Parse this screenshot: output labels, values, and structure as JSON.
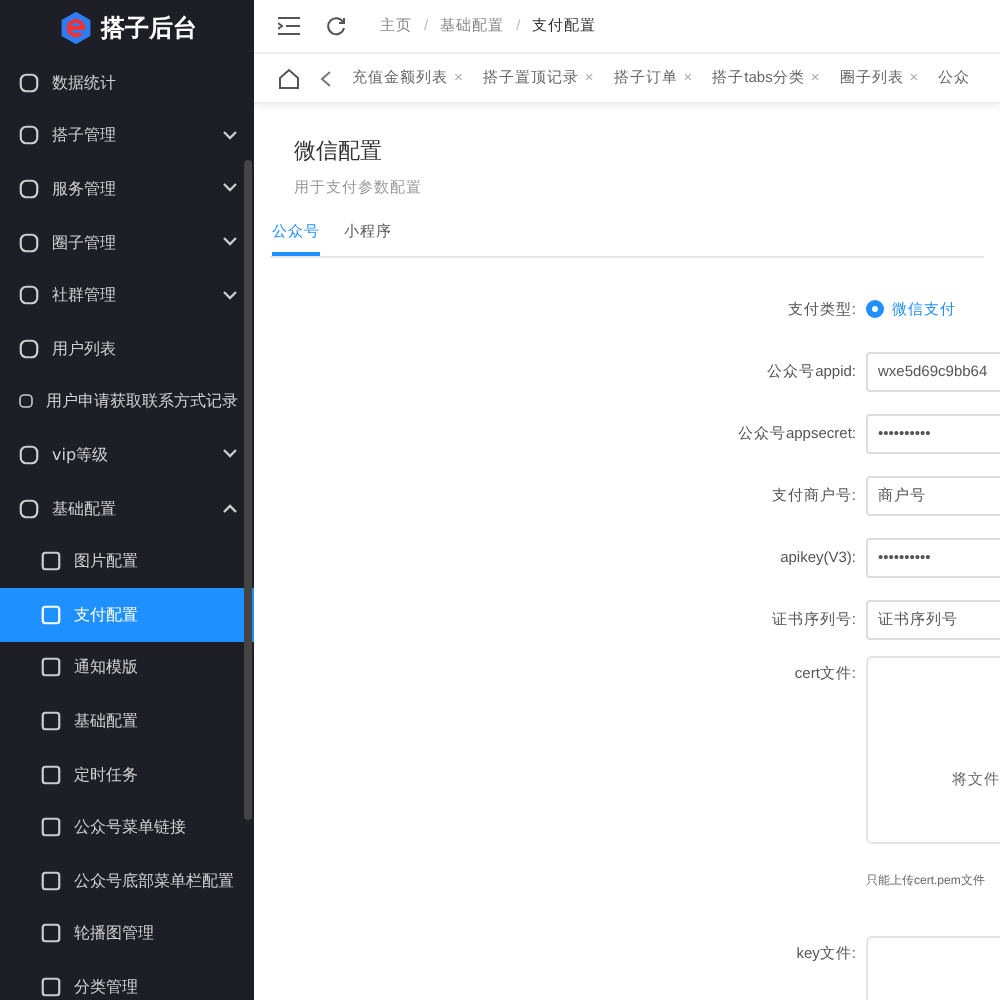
{
  "sidebar": {
    "logo_text": "搭子后台",
    "items": [
      {
        "label": "数据统计"
      },
      {
        "label": "搭子管理",
        "expanded": false
      },
      {
        "label": "服务管理",
        "expanded": false
      },
      {
        "label": "圈子管理",
        "expanded": false
      },
      {
        "label": "社群管理",
        "expanded": false
      },
      {
        "label": "用户列表"
      },
      {
        "label": "用户申请获取联系方式记录"
      },
      {
        "label": "vip等级",
        "expanded": false
      },
      {
        "label": "基础配置",
        "expanded": true,
        "children": [
          {
            "label": "图片配置",
            "selected": false
          },
          {
            "label": "支付配置",
            "selected": true
          },
          {
            "label": "通知模版",
            "selected": false
          },
          {
            "label": "基础配置",
            "selected": false
          },
          {
            "label": "定时任务",
            "selected": false
          },
          {
            "label": "公众号菜单链接",
            "selected": false
          },
          {
            "label": "公众号底部菜单栏配置",
            "selected": false
          },
          {
            "label": "轮播图管理",
            "selected": false
          },
          {
            "label": "分类管理",
            "selected": false
          }
        ]
      }
    ]
  },
  "breadcrumb": [
    {
      "label": "主页"
    },
    {
      "separator": "/",
      "label": "基础配置"
    },
    {
      "separator": "/",
      "label": "支付配置"
    }
  ],
  "tags": [
    {
      "label": "充值金额列表",
      "close": "×"
    },
    {
      "label": "搭子置顶记录",
      "close": "×"
    },
    {
      "label": "搭子订单",
      "close": "×"
    },
    {
      "label": "搭子tabs分类",
      "close": "×"
    },
    {
      "label": "圈子列表",
      "close": "×"
    },
    {
      "label": "公众"
    }
  ],
  "page": {
    "title": "微信配置",
    "subtitle": "用于支付参数配置"
  },
  "tabs": [
    {
      "label": "公众号",
      "selected": true
    },
    {
      "label": "小程序",
      "selected": false
    }
  ],
  "form": [
    {
      "kind": "radio",
      "label": "支付类型:",
      "options": [
        {
          "label": "微信支付",
          "selected": true
        }
      ]
    },
    {
      "kind": "input",
      "label": "公众号appid:",
      "value": "wxe5d69c9bb64"
    },
    {
      "kind": "input",
      "label": "公众号appsecret:",
      "value": "••••••••••"
    },
    {
      "kind": "input",
      "label": "支付商户号:",
      "placeholder": "商户号"
    },
    {
      "kind": "input",
      "label": "apikey(V3):",
      "value": "••••••••••"
    },
    {
      "kind": "input",
      "label": "证书序列号:",
      "placeholder": "证书序列号"
    },
    {
      "kind": "upload",
      "label": "cert文件:",
      "text": "将文件",
      "hint": "只能上传cert.pem文件"
    },
    {
      "kind": "upload",
      "label": "key文件:"
    }
  ]
}
